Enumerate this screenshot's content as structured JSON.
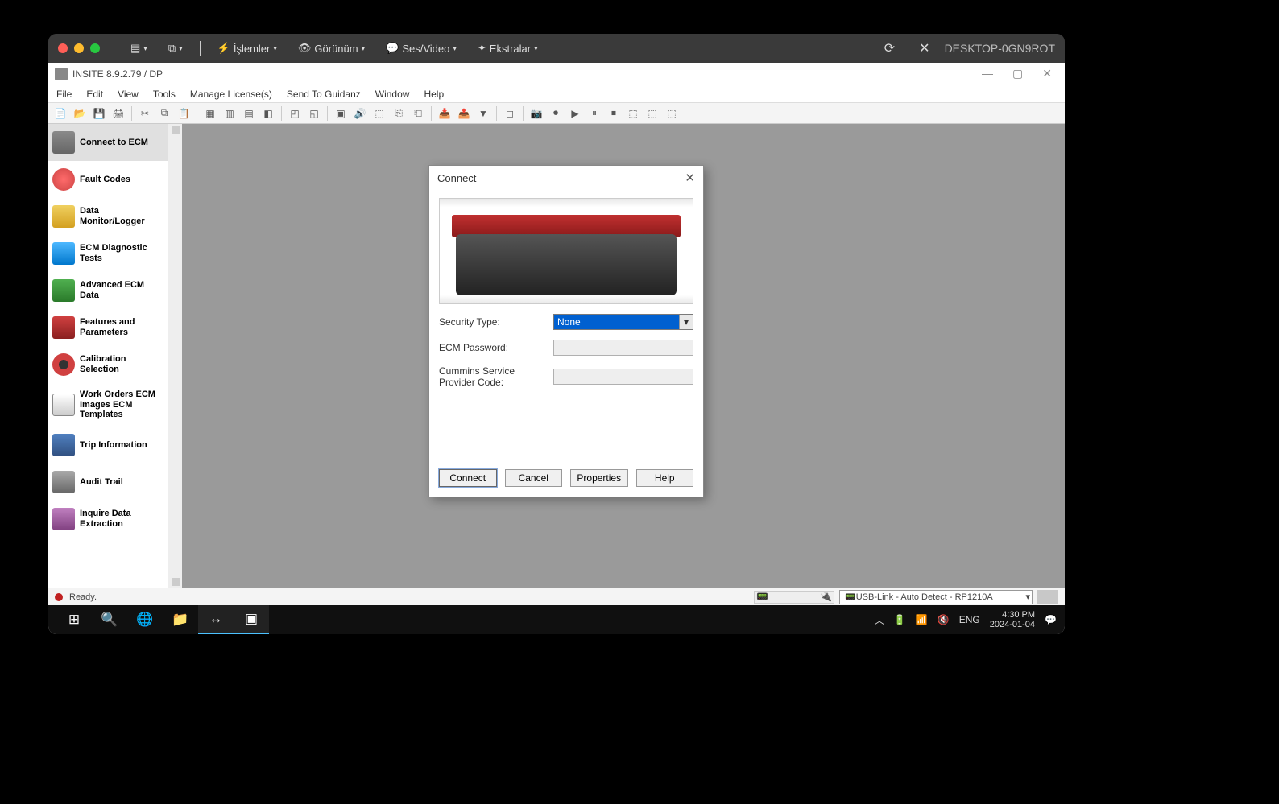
{
  "mac": {
    "menus": {
      "islemler": "İşlemler",
      "gorunum": "Görünüm",
      "sesvideo": "Ses/Video",
      "ekstralar": "Ekstralar"
    },
    "desktop": "DESKTOP-0GN9ROT"
  },
  "app": {
    "title": "INSITE 8.9.2.79  / DP",
    "menus": {
      "file": "File",
      "edit": "Edit",
      "view": "View",
      "tools": "Tools",
      "manage": "Manage License(s)",
      "send": "Send To Guidanz",
      "window": "Window",
      "help": "Help"
    }
  },
  "sidebar": {
    "items": [
      {
        "label": "Connect to ECM"
      },
      {
        "label": "Fault Codes"
      },
      {
        "label": "Data Monitor/Logger"
      },
      {
        "label": "ECM Diagnostic Tests"
      },
      {
        "label": "Advanced ECM Data"
      },
      {
        "label": "Features and Parameters"
      },
      {
        "label": "Calibration Selection"
      },
      {
        "label": "Work Orders ECM Images ECM Templates"
      },
      {
        "label": "Trip Information"
      },
      {
        "label": "Audit Trail"
      },
      {
        "label": "Inquire Data Extraction"
      }
    ]
  },
  "dialog": {
    "title": "Connect",
    "securityLabel": "Security Type:",
    "securityValue": "None",
    "passwordLabel": "ECM Password:",
    "providerLabel": "Cummins Service Provider Code:",
    "buttons": {
      "connect": "Connect",
      "cancel": "Cancel",
      "properties": "Properties",
      "help": "Help"
    }
  },
  "status": {
    "ready": "Ready.",
    "adapter": "USB-Link - Auto Detect - RP1210A"
  },
  "tray": {
    "lang": "ENG",
    "time": "4:30 PM",
    "date": "2024-01-04"
  }
}
